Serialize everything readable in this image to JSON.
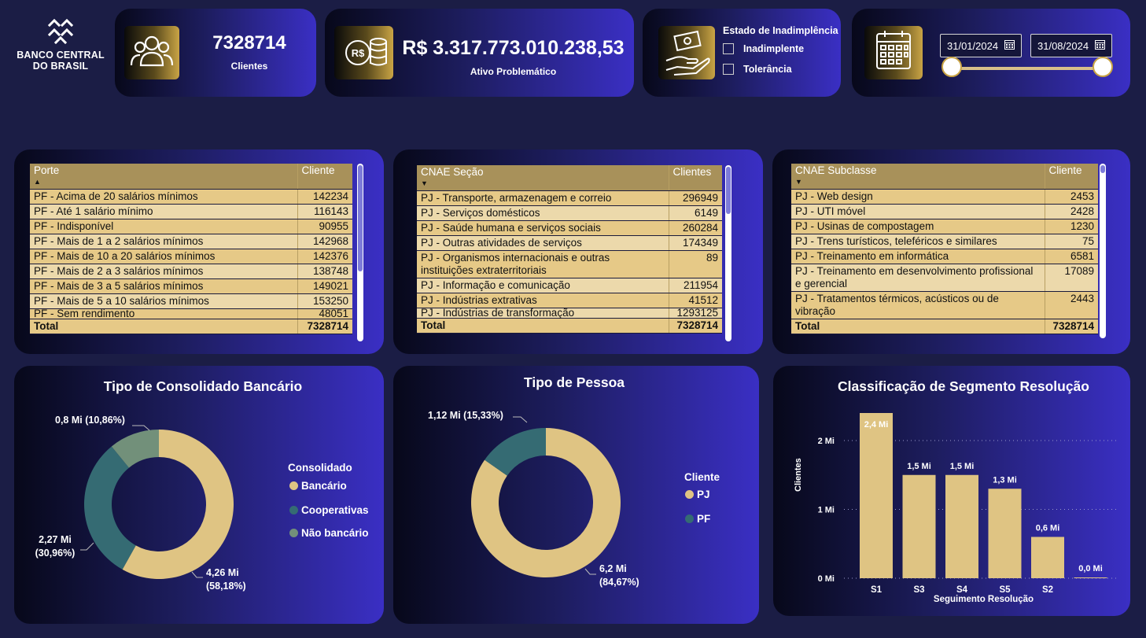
{
  "logo": {
    "line1": "BANCO CENTRAL",
    "line2": "DO BRASIL"
  },
  "kpi_clients": {
    "value": "7328714",
    "label": "Clientes",
    "icon": "users-icon"
  },
  "kpi_asset": {
    "value": "R$ 3.317.773.010.238,53",
    "label": "Ativo Problemático",
    "icon": "money-coins-icon"
  },
  "filter_state": {
    "title": "Estado de Inadimplência",
    "options": [
      "Inadimplente",
      "Tolerância"
    ],
    "icon": "hand-money-icon"
  },
  "date_filter": {
    "start": "31/01/2024",
    "end": "31/08/2024",
    "icon": "calendar-icon"
  },
  "table_porte": {
    "headers": [
      "Porte",
      "Cliente"
    ],
    "rows": [
      [
        "PF - Acima de 20 salários mínimos",
        "142234"
      ],
      [
        "PF - Até 1 salário mínimo",
        "116143"
      ],
      [
        "PF - Indisponível",
        "90955"
      ],
      [
        "PF - Mais de 1 a 2 salários mínimos",
        "142968"
      ],
      [
        "PF - Mais de 10 a 20 salários mínimos",
        "142376"
      ],
      [
        "PF - Mais de 2 a 3 salários mínimos",
        "138748"
      ],
      [
        "PF - Mais de 3 a 5 salários mínimos",
        "149021"
      ],
      [
        "PF - Mais de 5 a 10 salários mínimos",
        "153250"
      ],
      [
        "PF - Sem rendimento",
        "48051"
      ]
    ],
    "total": [
      "Total",
      "7328714"
    ]
  },
  "table_cnae_secao": {
    "headers": [
      "CNAE Seção",
      "Clientes"
    ],
    "rows": [
      [
        "PJ - Transporte, armazenagem e correio",
        "296949"
      ],
      [
        "PJ - Serviços domésticos",
        "6149"
      ],
      [
        "PJ - Saúde humana e serviços sociais",
        "260284"
      ],
      [
        "PJ - Outras atividades de serviços",
        "174349"
      ],
      [
        "PJ - Organismos internacionais e outras instituições extraterritoriais",
        "89"
      ],
      [
        "PJ - Informação e comunicação",
        "211954"
      ],
      [
        "PJ - Indústrias extrativas",
        "41512"
      ],
      [
        "PJ - Indústrias de transformação",
        "1293125"
      ]
    ],
    "total": [
      "Total",
      "7328714"
    ]
  },
  "table_cnae_subclasse": {
    "headers": [
      "CNAE Subclasse",
      "Cliente"
    ],
    "rows": [
      [
        "PJ - Web design",
        "2453"
      ],
      [
        "PJ - UTI móvel",
        "2428"
      ],
      [
        "PJ - Usinas de compostagem",
        "1230"
      ],
      [
        "PJ - Trens turísticos, teleféricos e similares",
        "75"
      ],
      [
        "PJ - Treinamento em informática",
        "6581"
      ],
      [
        "PJ - Treinamento em desenvolvimento profissional e gerencial",
        "17089"
      ],
      [
        "PJ - Tratamentos térmicos, acústicos ou de vibração",
        "2443"
      ]
    ],
    "total": [
      "Total",
      "7328714"
    ]
  },
  "colors": {
    "gold": "#dfc483",
    "teal": "#356b73",
    "sage": "#72907a",
    "gold_dark": "#a8915a"
  },
  "chart_data": [
    {
      "type": "pie",
      "title": "Tipo de Consolidado Bancário",
      "legend_title": "Consolidado",
      "categories": [
        "Bancário",
        "Cooperativas",
        "Não bancário"
      ],
      "values": [
        4.26,
        2.27,
        0.8
      ],
      "percents": [
        58.18,
        30.96,
        10.86
      ],
      "labels": [
        "4,26 Mi (58,18%)",
        "2,27 Mi (30,96%)",
        "0,8 Mi (10,86%)"
      ],
      "colors": [
        "#dfc483",
        "#356b73",
        "#72907a"
      ],
      "legend_placement": "right"
    },
    {
      "type": "pie",
      "title": "Tipo de Pessoa",
      "legend_title": "Cliente",
      "categories": [
        "PJ",
        "PF"
      ],
      "values": [
        6.2,
        1.12
      ],
      "percents": [
        84.67,
        15.33
      ],
      "labels": [
        "6,2 Mi (84,67%)",
        "1,12 Mi (15,33%)"
      ],
      "colors": [
        "#dfc483",
        "#356b73"
      ],
      "legend_placement": "right"
    },
    {
      "type": "bar",
      "title": "Classificação de Segmento Resolução",
      "categories": [
        "S1",
        "S3",
        "S4",
        "S5",
        "S2",
        ""
      ],
      "values": [
        2.4,
        1.5,
        1.5,
        1.3,
        0.6,
        0.0
      ],
      "data_labels": [
        "2,4 Mi",
        "1,5 Mi",
        "1,5 Mi",
        "1,3 Mi",
        "0,6 Mi",
        "0,0 Mi"
      ],
      "xlabel": "Seguimento Resolução",
      "ylabel": "Clientes",
      "yticks": [
        "0 Mi",
        "1 Mi",
        "2 Mi"
      ],
      "ylim": [
        0,
        2.4
      ],
      "grid": true,
      "color": "#dfc483"
    }
  ]
}
